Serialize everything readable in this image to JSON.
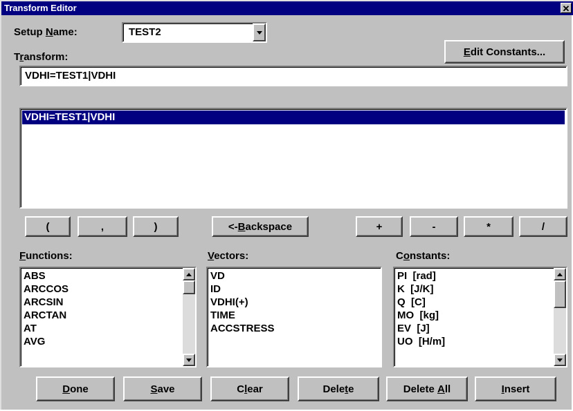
{
  "window": {
    "title": "Transform Editor",
    "close_glyph": "✕"
  },
  "setup": {
    "label_prefix": "Setup ",
    "label_accel": "N",
    "label_suffix": "ame:",
    "value": "TEST2"
  },
  "edit_constants": {
    "accel": "E",
    "rest": "dit Constants..."
  },
  "transform": {
    "label_prefix": "T",
    "label_accel": "r",
    "label_suffix": "ansform:",
    "value": "VDHI=TEST1|VDHI",
    "list": [
      "VDHI=TEST1|VDHI"
    ]
  },
  "operators": {
    "open_paren": "(",
    "comma": ",",
    "close_paren": ")",
    "backspace_prefix": "<- ",
    "backspace_accel": "B",
    "backspace_rest": "ackspace",
    "plus": "+",
    "minus": "-",
    "multiply": "*",
    "divide": "/"
  },
  "functions": {
    "label_accel": "F",
    "label_rest": "unctions:",
    "items": [
      "ABS",
      "ARCCOS",
      "ARCSIN",
      "ARCTAN",
      "AT",
      "AVG"
    ]
  },
  "vectors": {
    "label_accel": "V",
    "label_rest": "ectors:",
    "items": [
      "VD",
      "ID",
      "VDHI(+)",
      "TIME",
      "ACCSTRESS"
    ]
  },
  "constants": {
    "label_prefix": "C",
    "label_accel": "o",
    "label_rest": "nstants:",
    "items": [
      "PI  [rad]",
      "K  [J/K]",
      "Q  [C]",
      "MO  [kg]",
      "EV  [J]",
      "UO  [H/m]"
    ]
  },
  "buttons": {
    "done": {
      "accel": "D",
      "rest": "one"
    },
    "save": {
      "accel": "S",
      "rest": "ave"
    },
    "clear": {
      "prefix": "C",
      "accel": "l",
      "rest": "ear"
    },
    "delete": {
      "prefix": "Dele",
      "accel": "t",
      "rest": "e"
    },
    "delete_all": {
      "prefix": "Delete ",
      "accel": "A",
      "rest": "ll"
    },
    "insert": {
      "accel": "I",
      "rest": "nsert"
    }
  },
  "colors": {
    "window_bg": "#c0c0c0",
    "title_bg": "#000080",
    "selection_bg": "#000080"
  }
}
